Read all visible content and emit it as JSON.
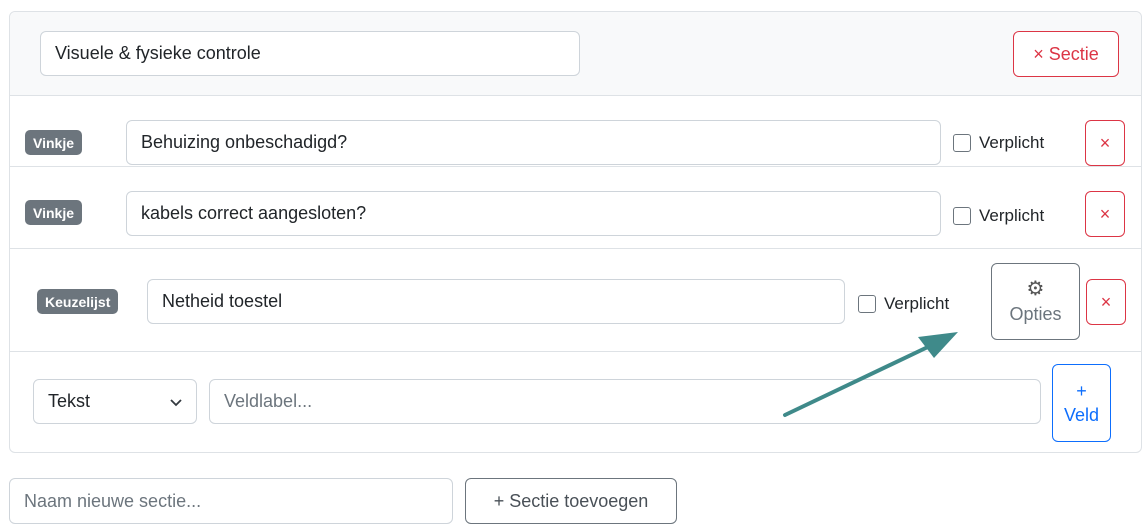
{
  "section": {
    "title_value": "Visuele & fysieke controle",
    "remove_section_label": "× Sectie"
  },
  "fields": [
    {
      "type_badge": "Vinkje",
      "label_value": "Behuizing onbeschadigd?",
      "required_label": "Verplicht",
      "required_checked": false,
      "remove_label": "×"
    },
    {
      "type_badge": "Vinkje",
      "label_value": "kabels correct aangesloten?",
      "required_label": "Verplicht",
      "required_checked": false,
      "remove_label": "×"
    },
    {
      "type_badge": "Keuzelijst",
      "label_value": "Netheid toestel",
      "required_label": "Verplicht",
      "required_checked": false,
      "options_label": "Opties",
      "options_icon": "gear-icon",
      "remove_label": "×"
    }
  ],
  "new_field": {
    "type_selected": "Tekst",
    "label_placeholder": "Veldlabel...",
    "add_plus": "+",
    "add_label": "Veld"
  },
  "new_section": {
    "name_placeholder": "Naam nieuwe sectie...",
    "add_label": "+ Sectie toevoegen"
  },
  "annotation": {
    "arrow_color": "#3f8a8a",
    "arrow_target": "options-button"
  },
  "colors": {
    "danger": "#dc3545",
    "primary": "#0d6efd",
    "secondary": "#6c757d",
    "border": "#dee2e6"
  }
}
